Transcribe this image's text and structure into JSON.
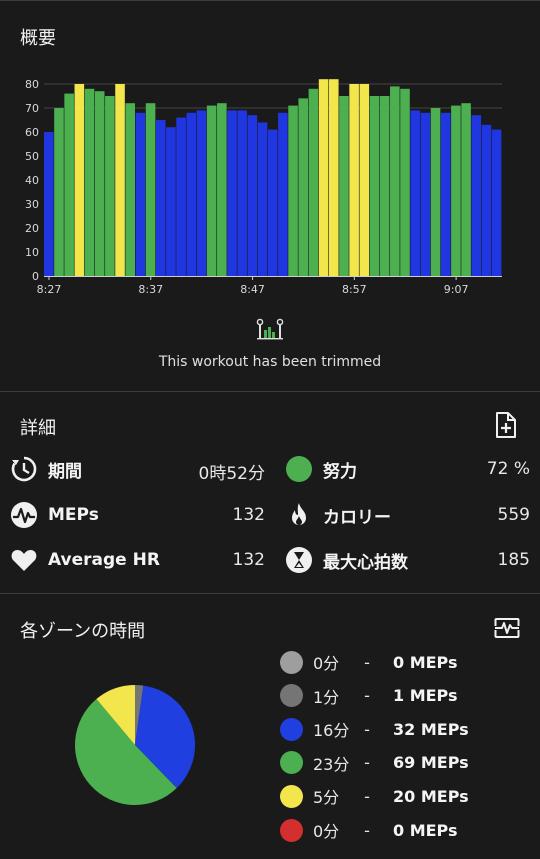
{
  "overview": {
    "title": "概要",
    "trimmed_text": "This workout has been trimmed"
  },
  "chart_data": {
    "type": "bar",
    "ylim": [
      0,
      90
    ],
    "yticks": [
      "0",
      "10",
      "20",
      "30",
      "40",
      "50",
      "60",
      "70",
      "80"
    ],
    "xticks": [
      "8:27",
      "8:37",
      "8:47",
      "8:57",
      "9:07"
    ],
    "colors": {
      "blue": "#1f36e0",
      "green": "#4caf50",
      "yellow": "#f2e64c"
    },
    "values": [
      60,
      70,
      76,
      80,
      78,
      77,
      75,
      80,
      72,
      68,
      72,
      65,
      62,
      66,
      68,
      69,
      71,
      72,
      69,
      69,
      67,
      64,
      61,
      68,
      71,
      74,
      78,
      82,
      82,
      75,
      80,
      80,
      75,
      75,
      79,
      78,
      69,
      68,
      70,
      68,
      71,
      72,
      67,
      63,
      61
    ],
    "zones": [
      "blue",
      "green",
      "green",
      "yellow",
      "green",
      "green",
      "green",
      "yellow",
      "green",
      "blue",
      "green",
      "blue",
      "blue",
      "blue",
      "blue",
      "blue",
      "green",
      "green",
      "blue",
      "blue",
      "blue",
      "blue",
      "blue",
      "blue",
      "green",
      "green",
      "green",
      "yellow",
      "yellow",
      "green",
      "yellow",
      "yellow",
      "green",
      "green",
      "green",
      "green",
      "blue",
      "blue",
      "green",
      "blue",
      "green",
      "green",
      "blue",
      "blue",
      "blue"
    ]
  },
  "details": {
    "title": "詳細",
    "add_icon": "note-add-icon",
    "items": [
      {
        "icon": "duration-icon",
        "label": "期間",
        "value": "0時52分"
      },
      {
        "icon": "effort-icon",
        "label": "努力",
        "value": "72 %"
      },
      {
        "icon": "meps-icon",
        "label": "MEPs",
        "value": "132"
      },
      {
        "icon": "flame-icon",
        "label": "カロリー",
        "value": "559"
      },
      {
        "icon": "heart-icon",
        "label": "Average HR",
        "value": "132"
      },
      {
        "icon": "hourglass-icon",
        "label": "最大心拍数",
        "value": "185"
      }
    ]
  },
  "zones": {
    "title": "各ゾーンの時間",
    "settings_icon": "zone-settings-icon",
    "sep": "-",
    "legend": [
      {
        "color": "#9e9e9e",
        "minutes": "0分",
        "meps": "0 MEPs",
        "value": 0
      },
      {
        "color": "#757575",
        "minutes": "1分",
        "meps": "1 MEPs",
        "value": 1
      },
      {
        "color": "#1f3fe0",
        "minutes": "16分",
        "meps": "32 MEPs",
        "value": 16
      },
      {
        "color": "#4caf50",
        "minutes": "23分",
        "meps": "69 MEPs",
        "value": 23
      },
      {
        "color": "#f2e64c",
        "minutes": "5分",
        "meps": "20 MEPs",
        "value": 5
      },
      {
        "color": "#d32f2f",
        "minutes": "0分",
        "meps": "0 MEPs",
        "value": 0
      }
    ]
  }
}
